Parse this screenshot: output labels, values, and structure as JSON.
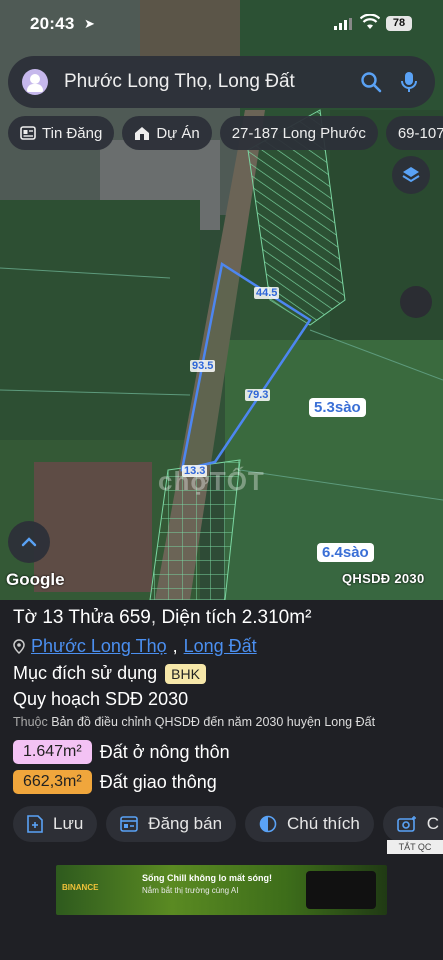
{
  "status_bar": {
    "time": "20:43",
    "battery": "78"
  },
  "search": {
    "value": "Phước Long Thọ, Long Đất"
  },
  "chips": [
    {
      "label": "Tin Đăng",
      "icon": "newspaper-icon"
    },
    {
      "label": "Dự Án",
      "icon": "building-icon"
    },
    {
      "label": "27-187 Long Phước",
      "icon": ""
    },
    {
      "label": "69-107",
      "icon": ""
    }
  ],
  "map": {
    "plot_edges": [
      "44.5",
      "93.5",
      "79.3",
      "13.3"
    ],
    "area_labels": [
      "5.3sào",
      "6.4sào"
    ],
    "watermark": "chợTỐT",
    "attribution": "Google",
    "layer_label": "QHSDĐ 2030"
  },
  "parcel": {
    "sheet": "Tờ 13",
    "plot": "Thửa 659",
    "area_prefix": "Diện tích",
    "area_value": "2.310m²",
    "ward": "Phước Long Thọ",
    "district": "Long Đất",
    "purpose_label": "Mục đích sử dụng",
    "purpose_code": "BHK",
    "plan_label": "Quy hoạch SDĐ 2030",
    "note_prefix": "Thuộc",
    "note_text": "Bản đồ điều chỉnh QHSDĐ đến năm 2030 huyện Long Đất",
    "zones": [
      {
        "value": "1.647m²",
        "label": "Đất ở nông thôn",
        "color": "#f3c2f4"
      },
      {
        "value": "662,3m²",
        "label": "Đất giao thông",
        "color": "#f0a63c"
      }
    ]
  },
  "actions": [
    {
      "label": "Lưu",
      "icon": "save-icon"
    },
    {
      "label": "Đăng bán",
      "icon": "listing-icon"
    },
    {
      "label": "Chú thích",
      "icon": "contrast-icon"
    },
    {
      "label": "C",
      "icon": "camera-icon"
    }
  ],
  "ad": {
    "close_label": "TẮT QC",
    "brand": "BINANCE",
    "headline": "Sống Chill không lo mất sóng!",
    "subline": "Nắm bắt thị trường cùng AI"
  }
}
